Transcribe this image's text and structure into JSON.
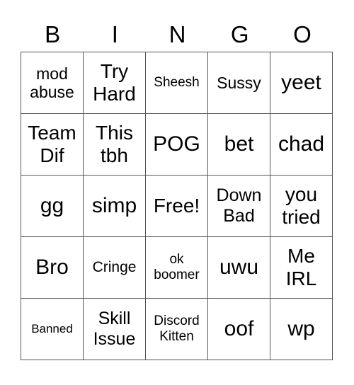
{
  "header": [
    "B",
    "I",
    "N",
    "G",
    "O"
  ],
  "board": [
    [
      "mod\nabuse",
      "Try\nHard",
      "Sheesh",
      "Sussy",
      "yeet"
    ],
    [
      "Team\nDif",
      "This\ntbh",
      "POG",
      "bet",
      "chad"
    ],
    [
      "gg",
      "simp",
      "Free!",
      "Down\nBad",
      "you\ntried"
    ],
    [
      "Bro",
      "Cringe",
      "ok\nboomer",
      "uwu",
      "Me\nIRL"
    ],
    [
      "Banned",
      "Skill\nIssue",
      "Discord\nKitten",
      "oof",
      "wp"
    ]
  ]
}
